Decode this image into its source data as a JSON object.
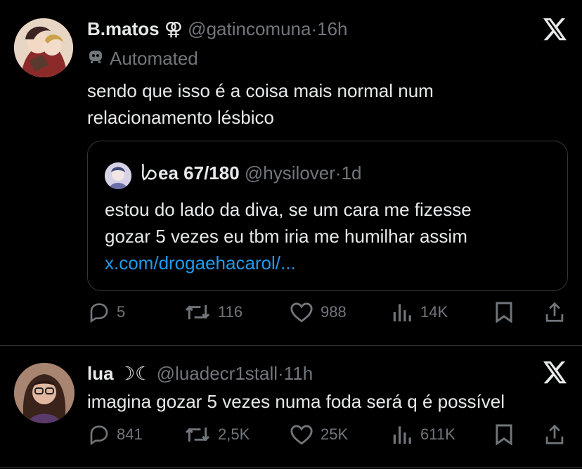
{
  "tweets": [
    {
      "display_name": "B.matos",
      "name_symbol": "⚢",
      "handle": "@gatincomuna",
      "sep": "·",
      "time": "16h",
      "automated_label": "Automated",
      "text_lines": [
        "sendo que isso é a coisa mais normal num",
        "relacionamento lésbico"
      ],
      "quote": {
        "display_name": "ea 67/180",
        "handle": "@hysilover",
        "sep": "·",
        "time": "1d",
        "text_lines": [
          "estou do lado da diva, se um cara me fizesse",
          "gozar 5 vezes eu tbm iria me humilhar assim"
        ],
        "link": "x.com/drogaehacarol/..."
      },
      "actions": {
        "replies": "5",
        "reposts": "116",
        "likes": "988",
        "views": "14K"
      }
    },
    {
      "display_name": "lua",
      "name_symbol": "☽☾",
      "handle": "@luadecr1stall",
      "sep": "·",
      "time": "11h",
      "text_lines": [
        "imagina gozar 5 vezes numa foda será q é possível"
      ],
      "actions": {
        "replies": "841",
        "reposts": "2,5K",
        "likes": "25K",
        "views": "611K"
      }
    }
  ],
  "icons": [
    "x-logo-icon",
    "robot-icon",
    "reply-icon",
    "repost-icon",
    "like-icon",
    "views-icon",
    "bookmark-icon",
    "share-icon"
  ],
  "colors": {
    "background": "#000000",
    "text": "#e7e9ea",
    "muted": "#71767b",
    "link": "#1d9bf0",
    "border": "#333639"
  }
}
